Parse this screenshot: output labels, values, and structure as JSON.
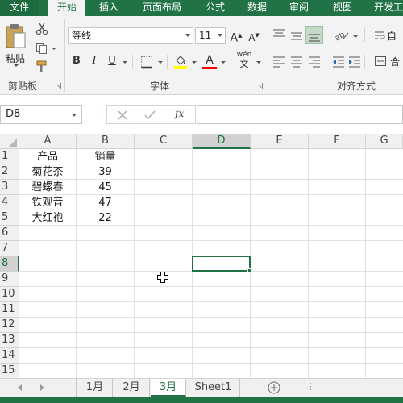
{
  "tabs": [
    {
      "label": "文件",
      "active": false
    },
    {
      "label": "开始",
      "active": true
    },
    {
      "label": "插入",
      "active": false
    },
    {
      "label": "页面布局",
      "active": false
    },
    {
      "label": "公式",
      "active": false
    },
    {
      "label": "数据",
      "active": false
    },
    {
      "label": "审阅",
      "active": false
    },
    {
      "label": "视图",
      "active": false
    },
    {
      "label": "开发工",
      "active": false
    }
  ],
  "ribbon": {
    "clipboard": {
      "paste_label": "粘贴",
      "group_label": "剪贴板"
    },
    "font": {
      "font_name": "等线",
      "font_size": "11",
      "bold": "B",
      "italic": "I",
      "underline": "U",
      "grow": "A",
      "shrink": "A",
      "font_color_letter": "A",
      "phonetic": "wén",
      "group_label": "字体"
    },
    "alignment": {
      "group_label": "对齐方式",
      "wrap_partial": "自"
    },
    "colors": {
      "fill_bar": "#ffff00",
      "font_bar": "#ff0000",
      "accent": "#217346"
    }
  },
  "formula_bar": {
    "name_box": "D8",
    "fx_label": "fx",
    "value": ""
  },
  "columns": [
    "A",
    "B",
    "C",
    "D",
    "E",
    "F",
    "G"
  ],
  "rows": [
    "1",
    "2",
    "3",
    "4",
    "5",
    "6",
    "7",
    "8",
    "9",
    "10",
    "11",
    "12",
    "13",
    "14",
    "15"
  ],
  "selected": {
    "column": "D",
    "row": "8"
  },
  "table": {
    "headers": [
      "产品",
      "销量"
    ],
    "rows": [
      [
        "菊花茶",
        "39"
      ],
      [
        "碧螺春",
        "45"
      ],
      [
        "铁观音",
        "47"
      ],
      [
        "大红袍",
        "22"
      ]
    ]
  },
  "sheets": [
    {
      "label": "1月",
      "active": false
    },
    {
      "label": "2月",
      "active": false
    },
    {
      "label": "3月",
      "active": true
    },
    {
      "label": "Sheet1",
      "active": false
    }
  ]
}
